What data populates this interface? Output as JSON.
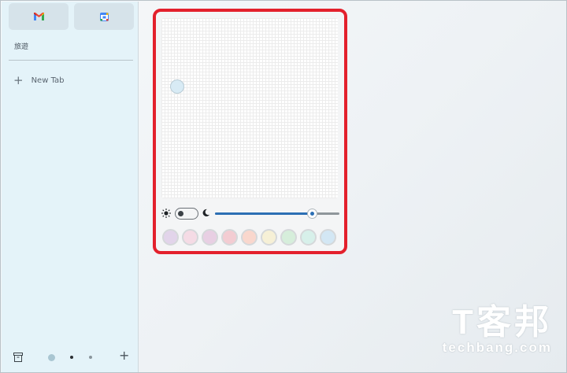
{
  "sidebar": {
    "pinned_tabs": [
      {
        "name": "gmail",
        "icon": "gmail-icon"
      },
      {
        "name": "calendar",
        "icon": "calendar-icon"
      }
    ],
    "group_label": "旅遊",
    "new_tab_label": "New Tab",
    "bottom": {
      "archive_icon": "archive-icon",
      "spaces": [
        "space-1",
        "space-2",
        "space-3"
      ],
      "add_icon": "plus-icon"
    }
  },
  "theme_panel": {
    "mode_toggle": {
      "light_icon": "sun-icon",
      "dark_icon": "moon-icon",
      "dark_enabled": false
    },
    "slider_value": 0.78,
    "swatches": [
      "#e2d4ea",
      "#f5dbe5",
      "#e8cfe3",
      "#f3ccd2",
      "#f9d7cd",
      "#f6f0d6",
      "#d6eedb",
      "#d7f0ea",
      "#d3e7f4"
    ],
    "accent_color": "#2c6fb4",
    "highlight_border_color": "#e3202c"
  },
  "watermark": {
    "cn": "T客邦",
    "en": "techbang.com"
  }
}
